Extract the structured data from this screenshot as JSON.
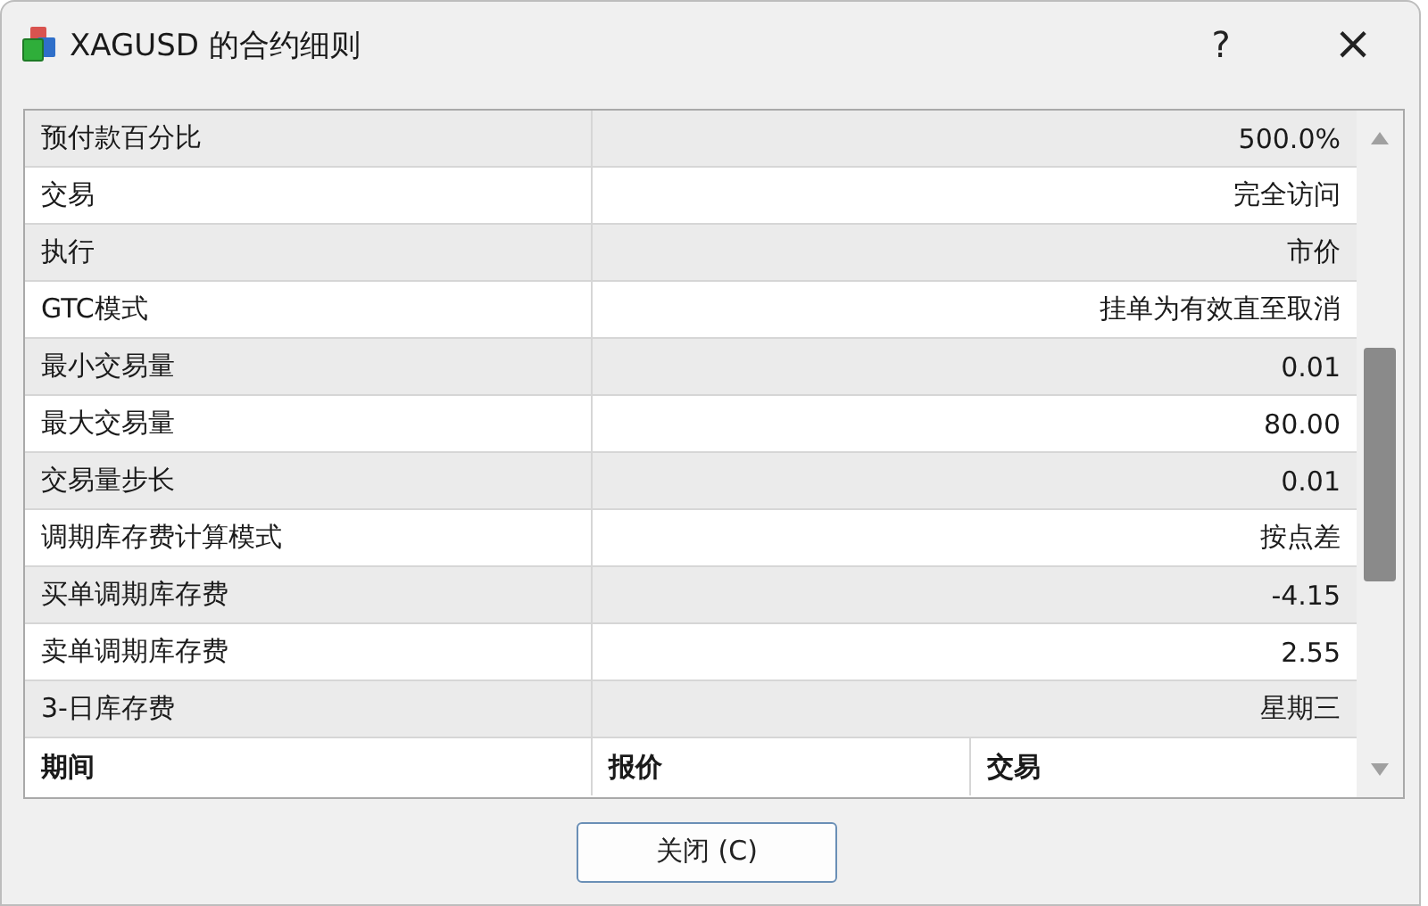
{
  "window": {
    "title": "XAGUSD 的合约细则",
    "help": "?",
    "close": "×"
  },
  "spec_rows": [
    {
      "label": "预付款百分比",
      "value": "500.0%"
    },
    {
      "label": "交易",
      "value": "完全访问"
    },
    {
      "label": "执行",
      "value": "市价"
    },
    {
      "label": "GTC模式",
      "value": "挂单为有效直至取消"
    },
    {
      "label": "最小交易量",
      "value": "0.01"
    },
    {
      "label": "最大交易量",
      "value": "80.00"
    },
    {
      "label": "交易量步长",
      "value": "0.01"
    },
    {
      "label": "调期库存费计算模式",
      "value": "按点差"
    },
    {
      "label": "买单调期库存费",
      "value": "-4.15"
    },
    {
      "label": "卖单调期库存费",
      "value": "2.55"
    },
    {
      "label": "3-日库存费",
      "value": "星期三"
    }
  ],
  "sessions_header": [
    "期间",
    "报价",
    "交易"
  ],
  "buttons": [
    {
      "label": "关闭 (C)"
    }
  ]
}
